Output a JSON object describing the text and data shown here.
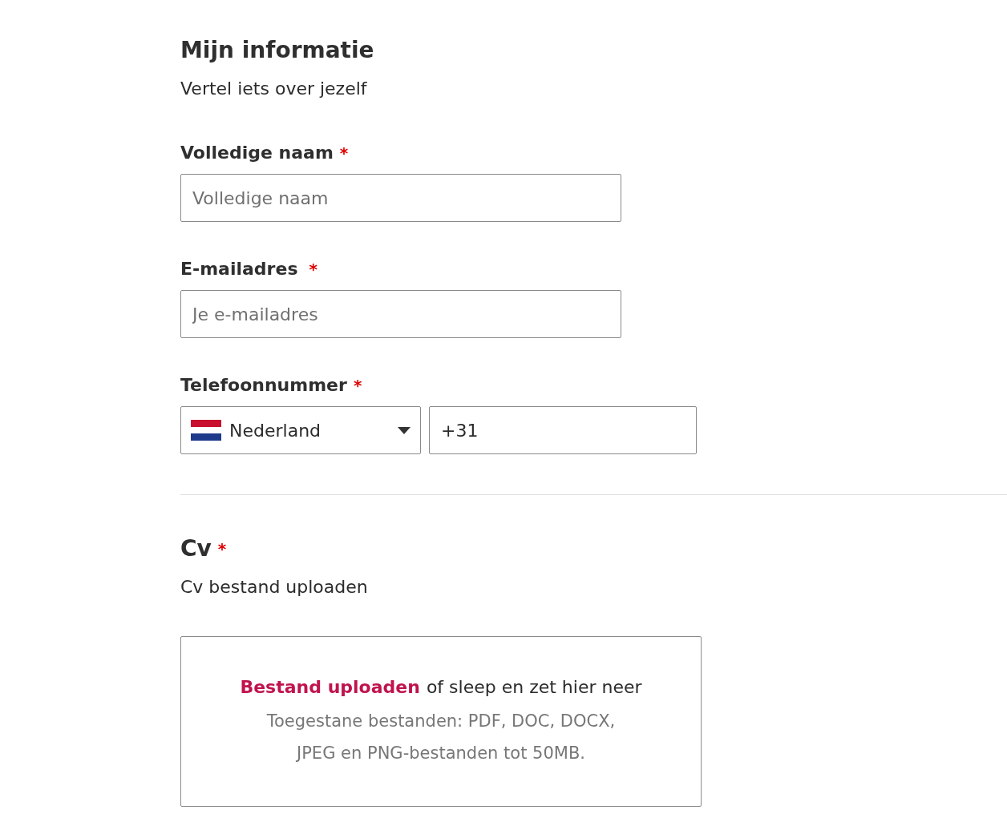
{
  "section": {
    "title": "Mijn informatie",
    "subtitle": "Vertel iets over jezelf"
  },
  "fields": [
    {
      "kind": "text",
      "label": "Volledige naam",
      "required_mark": "*",
      "placeholder": "Volledige naam"
    },
    {
      "kind": "text",
      "label": "E-mailadres",
      "required_mark": "*",
      "placeholder": "Je e-mailadres"
    },
    {
      "kind": "phone",
      "label": "Telefoonnummer",
      "required_mark": "*",
      "country": "Nederland",
      "value": "+31"
    }
  ],
  "cv": {
    "title": "Cv",
    "required_mark": "*",
    "subtitle": "Cv bestand uploaden",
    "upload_link": "Bestand uploaden",
    "upload_text": "of sleep en zet hier neer",
    "hint": "Toegestane bestanden: PDF, DOC, DOCX, JPEG en PNG-bestanden tot 50MB."
  }
}
